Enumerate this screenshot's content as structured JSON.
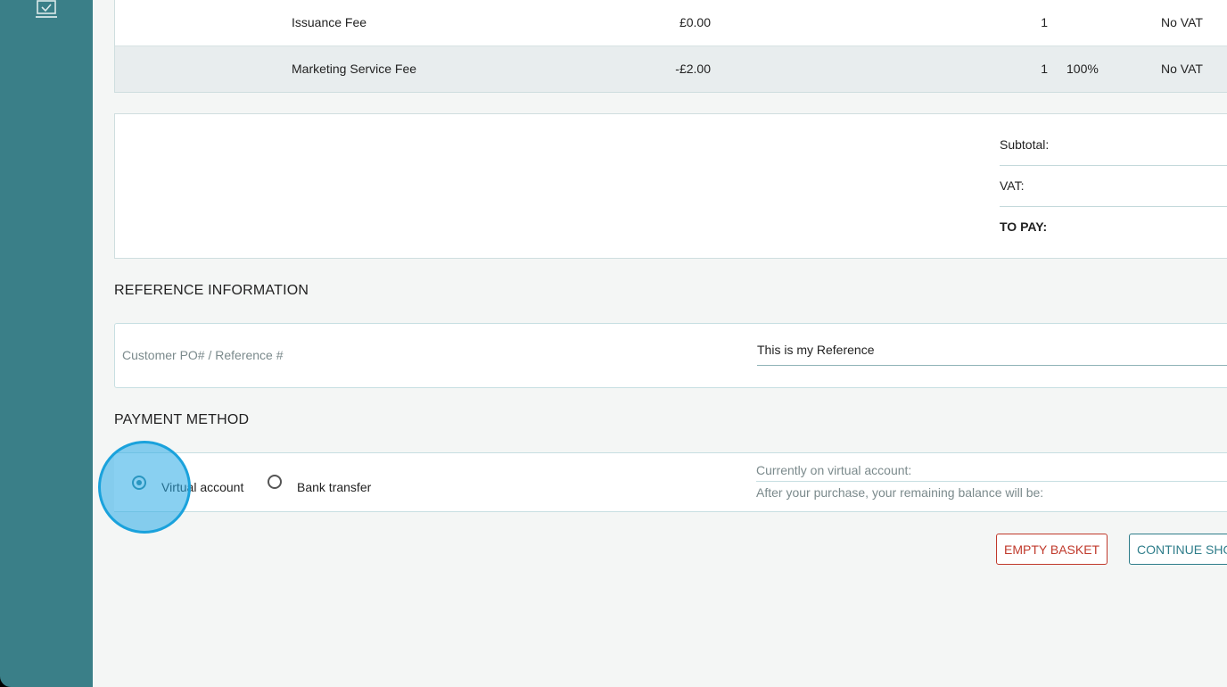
{
  "sidebar": {
    "icon": "laptop-check-icon"
  },
  "items": [
    {
      "name": "Issuance Fee",
      "price": "£0.00",
      "qty": "1",
      "discount": "",
      "vat": "No VAT"
    },
    {
      "name": "Marketing Service Fee",
      "price": "-£2.00",
      "qty": "1",
      "discount": "100%",
      "vat": "No VAT"
    }
  ],
  "totals": {
    "subtotal_label": "Subtotal:",
    "vat_label": "VAT:",
    "topay_label": "TO PAY:"
  },
  "reference": {
    "title": "REFERENCE INFORMATION",
    "label": "Customer PO# / Reference #",
    "value": "This is my Reference"
  },
  "payment": {
    "title": "PAYMENT METHOD",
    "options": [
      {
        "label": "Virtual account",
        "selected": true
      },
      {
        "label": "Bank transfer",
        "selected": false
      }
    ],
    "balance_current": "Currently on virtual account:",
    "balance_after": "After your purchase, your remaining balance will be:"
  },
  "actions": {
    "empty_basket": "EMPTY BASKET",
    "continue_shopping": "CONTINUE SHOPPING"
  },
  "colors": {
    "sidebar": "#3a7f88",
    "accent": "#2b7f95",
    "danger": "#c0392b",
    "highlight": "#1aa2dc"
  }
}
